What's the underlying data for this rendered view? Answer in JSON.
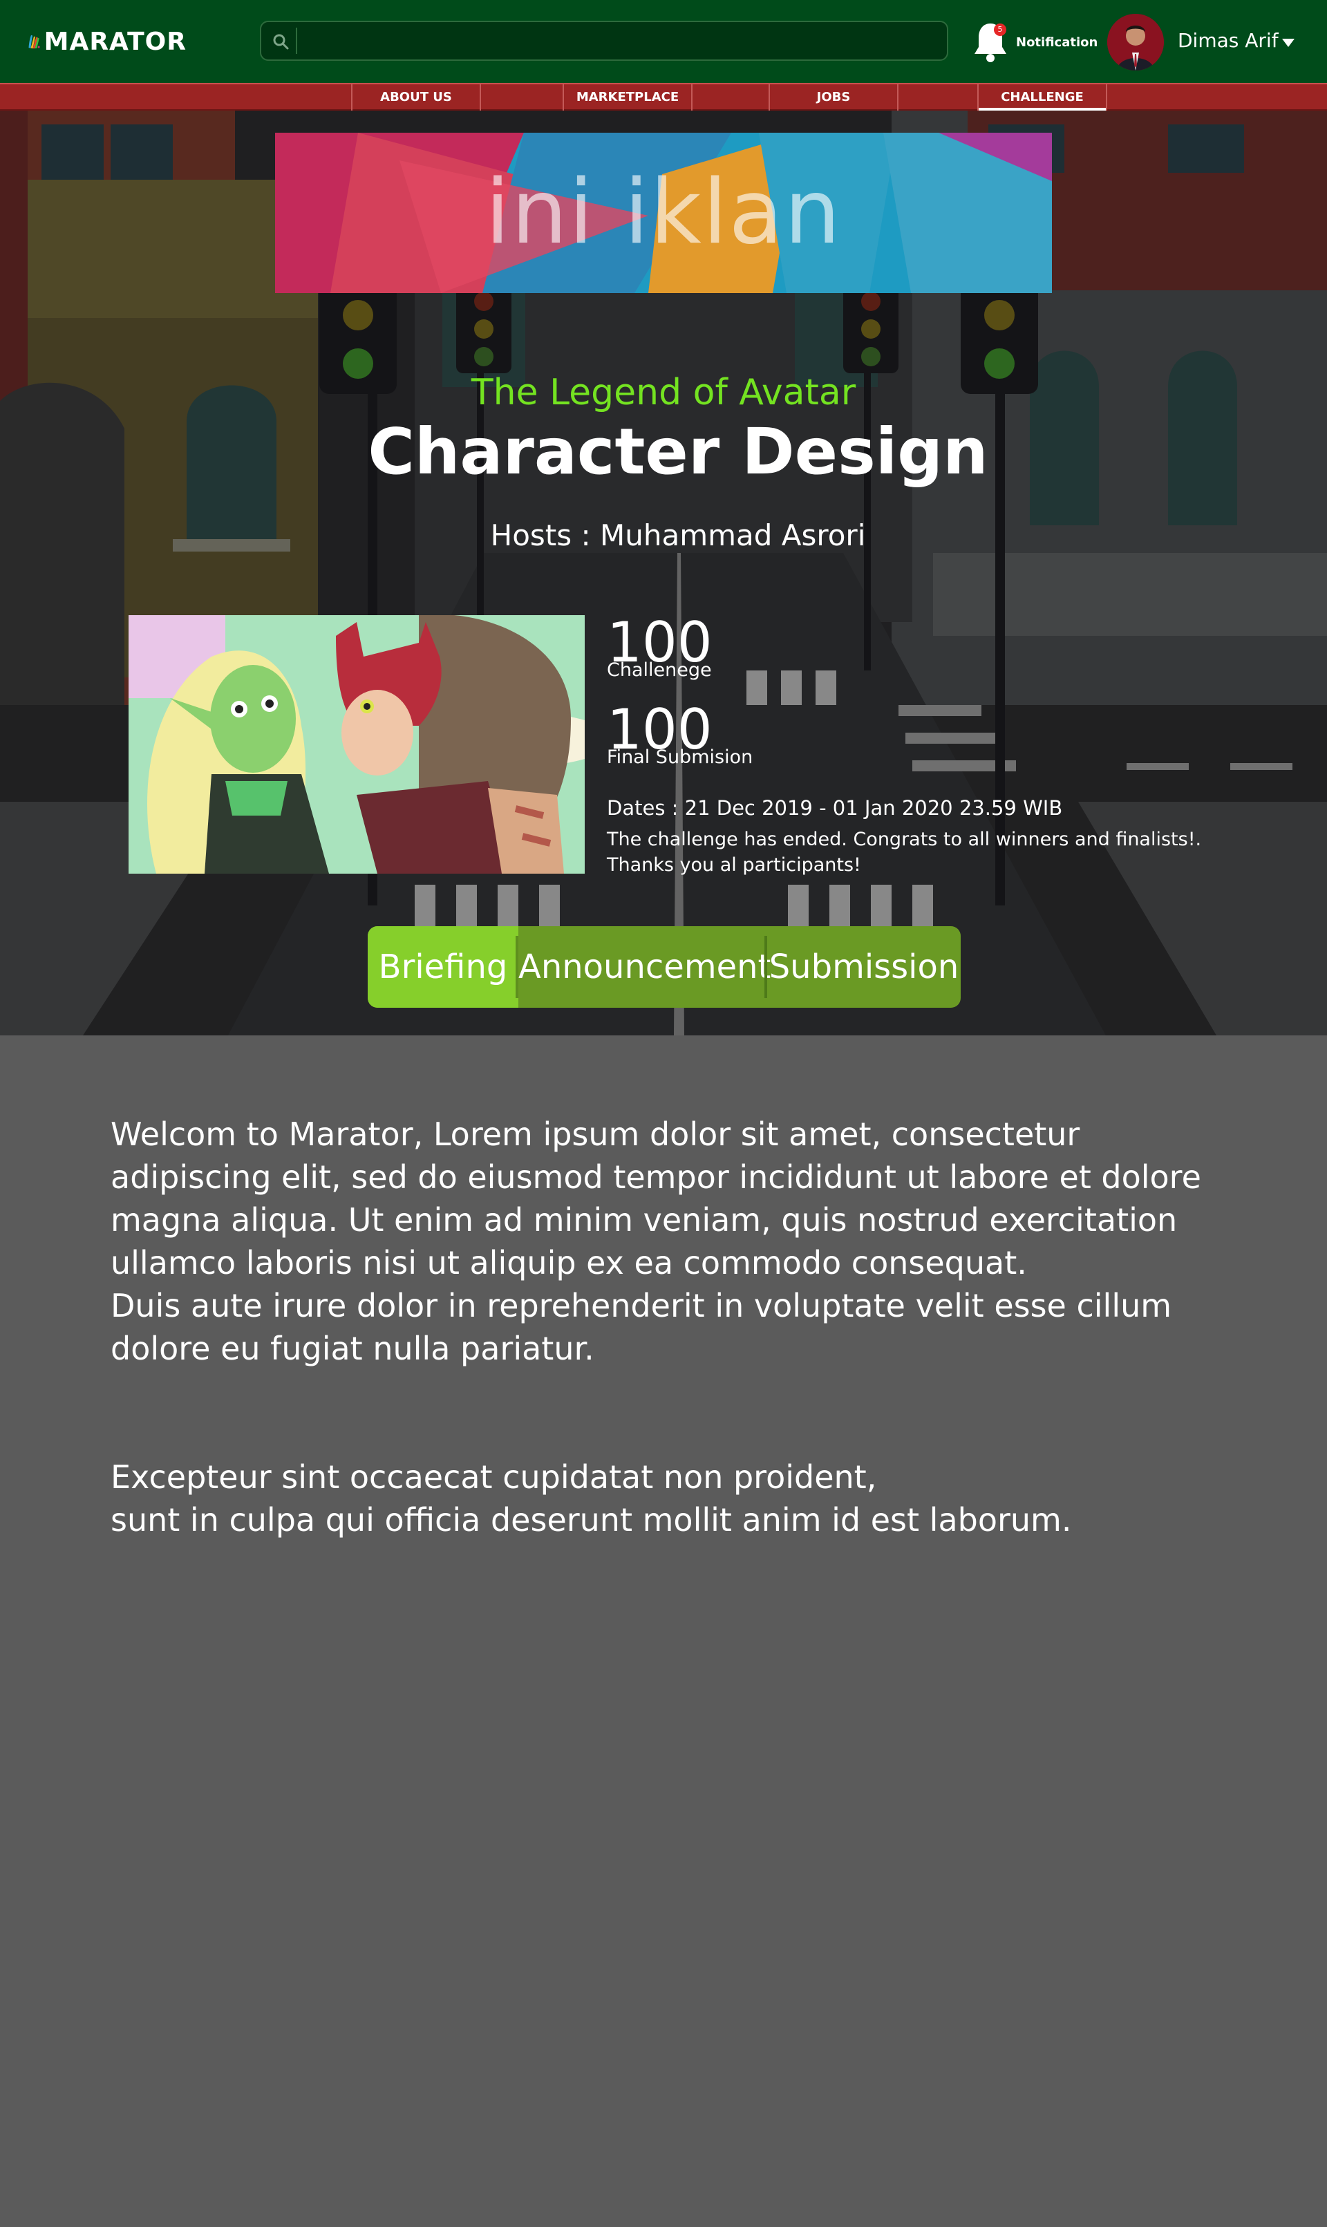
{
  "brand": {
    "name": "MARATOR"
  },
  "search": {
    "placeholder": ""
  },
  "header": {
    "notification_label": "Notification",
    "notification_count": "5",
    "user_name": "Dimas Arif"
  },
  "nav": {
    "items": [
      {
        "label": "ABOUT US"
      },
      {
        "label": "MARKETPLACE"
      },
      {
        "label": "JOBS"
      },
      {
        "label": "CHALLENGE"
      }
    ]
  },
  "ad": {
    "text": "ini iklan"
  },
  "challenge": {
    "subtitle": "The Legend of Avatar",
    "title": "Character Design",
    "hosts": "Hosts : Muhammad Asrori",
    "stats": [
      {
        "value": "100",
        "label": "Challenege"
      },
      {
        "value": "100",
        "label": "Final Submision"
      }
    ],
    "dates": "Dates : 21 Dec 2019 - 01 Jan 2020  23.59 WIB",
    "ended_line1": "The challenge has ended. Congrats to all winners and finalists!.",
    "ended_line2": "Thanks you al participants!"
  },
  "tabs": [
    {
      "label": "Briefing"
    },
    {
      "label": "Announcement"
    },
    {
      "label": "Submission"
    }
  ],
  "content": {
    "para1_lines": [
      "Welcom to Marator, Lorem ipsum dolor sit amet, consectetur",
      "adipiscing elit, sed do eiusmod tempor incididunt ut labore et dolore",
      "magna aliqua. Ut enim ad minim veniam, quis nostrud exercitation",
      "ullamco laboris nisi ut aliquip ex ea commodo consequat.",
      "Duis aute irure dolor in reprehenderit in voluptate velit esse cillum",
      "dolore eu fugiat nulla pariatur."
    ],
    "para2_lines": [
      "Excepteur sint occaecat cupidatat non proident,",
      "sunt in culpa qui officia deserunt mollit anim id est laborum."
    ]
  },
  "colors": {
    "topbar": "#004b1a",
    "nav": "#9b2423",
    "accent_green": "#74e321",
    "tab_active": "#86cf2b",
    "tab_bg": "#6a9a24",
    "page_bg": "#5b5b5b"
  },
  "icons": [
    "marator-logo-icon",
    "search-icon",
    "bell-icon",
    "chevron-down-icon"
  ]
}
